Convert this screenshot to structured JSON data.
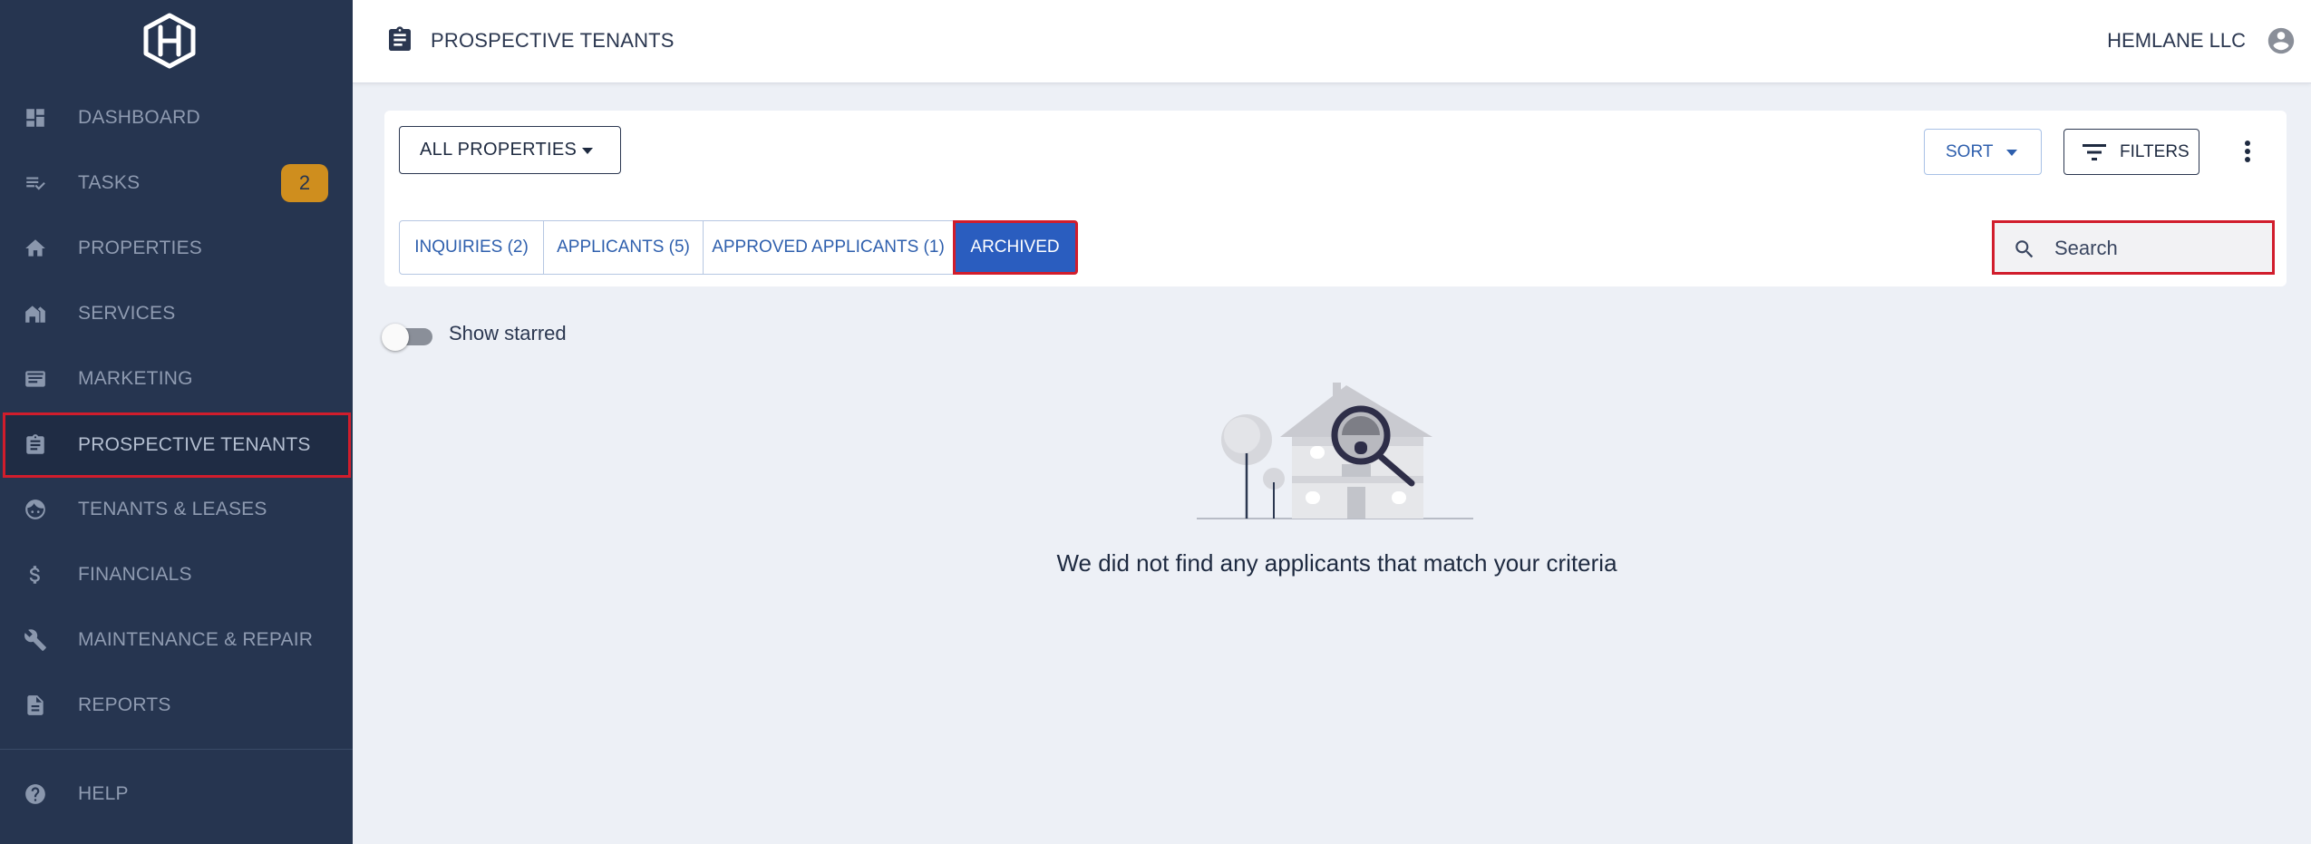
{
  "sidebar": {
    "logo_icon": "hemlane-hexagon-logo",
    "items": [
      {
        "label": "DASHBOARD",
        "icon": "dashboard-icon"
      },
      {
        "label": "TASKS",
        "icon": "tasks-icon",
        "badge": "2"
      },
      {
        "label": "PROPERTIES",
        "icon": "home-icon"
      },
      {
        "label": "SERVICES",
        "icon": "services-icon"
      },
      {
        "label": "MARKETING",
        "icon": "marketing-icon"
      },
      {
        "label": "PROSPECTIVE TENANTS",
        "icon": "clipboard-icon",
        "active": true
      },
      {
        "label": "TENANTS & LEASES",
        "icon": "tenant-face-icon"
      },
      {
        "label": "FINANCIALS",
        "icon": "dollar-icon"
      },
      {
        "label": "MAINTENANCE & REPAIR",
        "icon": "wrench-icon"
      },
      {
        "label": "REPORTS",
        "icon": "document-icon"
      }
    ],
    "help": {
      "label": "HELP",
      "icon": "help-icon"
    }
  },
  "header": {
    "title": "PROSPECTIVE TENANTS",
    "org_name": "HEMLANE LLC"
  },
  "toolbar": {
    "property_select": "ALL PROPERTIES",
    "sort_label": "SORT",
    "filters_label": "FILTERS"
  },
  "tabs": [
    {
      "label": "INQUIRIES (2)"
    },
    {
      "label": "APPLICANTS (5)"
    },
    {
      "label": "APPROVED APPLICANTS (1)"
    },
    {
      "label": "ARCHIVED",
      "active": true
    }
  ],
  "search": {
    "placeholder": "Search",
    "value": ""
  },
  "starred_toggle": {
    "label": "Show starred",
    "on": false
  },
  "empty_state": {
    "message": "We did not find any applicants that match your criteria"
  },
  "colors": {
    "sidebar_bg": "#263550",
    "accent_blue": "#2a5dbf",
    "badge": "#cf8e1e",
    "highlight_red": "#d11d2c",
    "page_bg": "#edf0f6"
  }
}
